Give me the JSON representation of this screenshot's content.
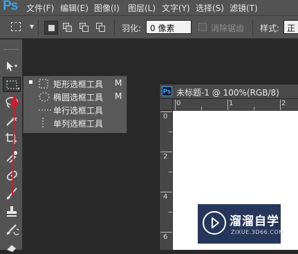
{
  "app": {
    "logo": "Ps"
  },
  "menu": {
    "items": [
      "文件(F)",
      "编辑(E)",
      "图像(I)",
      "图层(L)",
      "文字(Y)",
      "选择(S)",
      "滤镜(T)"
    ]
  },
  "options_bar": {
    "feather_label": "羽化:",
    "feather_value": "0 像素",
    "antialias_label": "消除锯齿",
    "style_label": "样式:",
    "style_value": "正"
  },
  "flyout": {
    "items": [
      {
        "label": "矩形选框工具",
        "shortcut": "M",
        "icon": "rect-marquee-icon",
        "selected": true
      },
      {
        "label": "椭圆选框工具",
        "shortcut": "M",
        "icon": "ellipse-marquee-icon",
        "selected": false
      },
      {
        "label": "单行选框工具",
        "shortcut": "",
        "icon": "single-row-marquee-icon",
        "selected": false
      },
      {
        "label": "单列选框工具",
        "shortcut": "",
        "icon": "single-column-marquee-icon",
        "selected": false
      }
    ]
  },
  "document": {
    "ps_badge": "Ps",
    "title": "未标题-1 @ 100%(RGB/8)",
    "ruler_top": [
      "0",
      "1",
      "2",
      "3",
      "4"
    ],
    "ruler_left": [
      "0",
      "1",
      "2",
      "3",
      "4",
      "5",
      "6"
    ]
  },
  "watermark": {
    "title": "溜溜自学",
    "url": "ZIXUE.3D66.COM"
  },
  "colors": {
    "chrome": "#535353",
    "workspace": "#282828",
    "ps_blue": "#3ea0e8",
    "annotation_red": "#d8182a"
  }
}
